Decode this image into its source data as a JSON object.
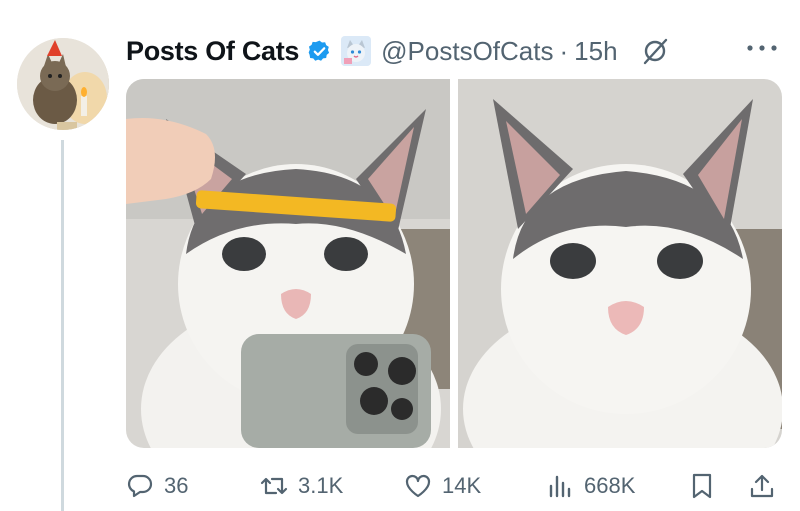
{
  "post": {
    "display_name": "Posts Of Cats",
    "handle": "@PostsOfCats",
    "separator": "·",
    "time": "15h",
    "verified": true,
    "accent_color": "#1d9bf0"
  },
  "media": {
    "images": [
      {
        "description_icon": "cat-photo-with-comb-and-phone"
      },
      {
        "description_icon": "cat-photo-closeup"
      }
    ]
  },
  "actions": {
    "replies": "36",
    "reposts": "3.1K",
    "likes": "14K",
    "views": "668K"
  },
  "icons": {
    "reply": "speech-bubble-icon",
    "repost": "repost-icon",
    "like": "heart-icon",
    "views": "bar-chart-icon",
    "bookmark": "bookmark-icon",
    "share": "share-icon",
    "grok": "grok-icon",
    "more": "more-dots-icon"
  }
}
